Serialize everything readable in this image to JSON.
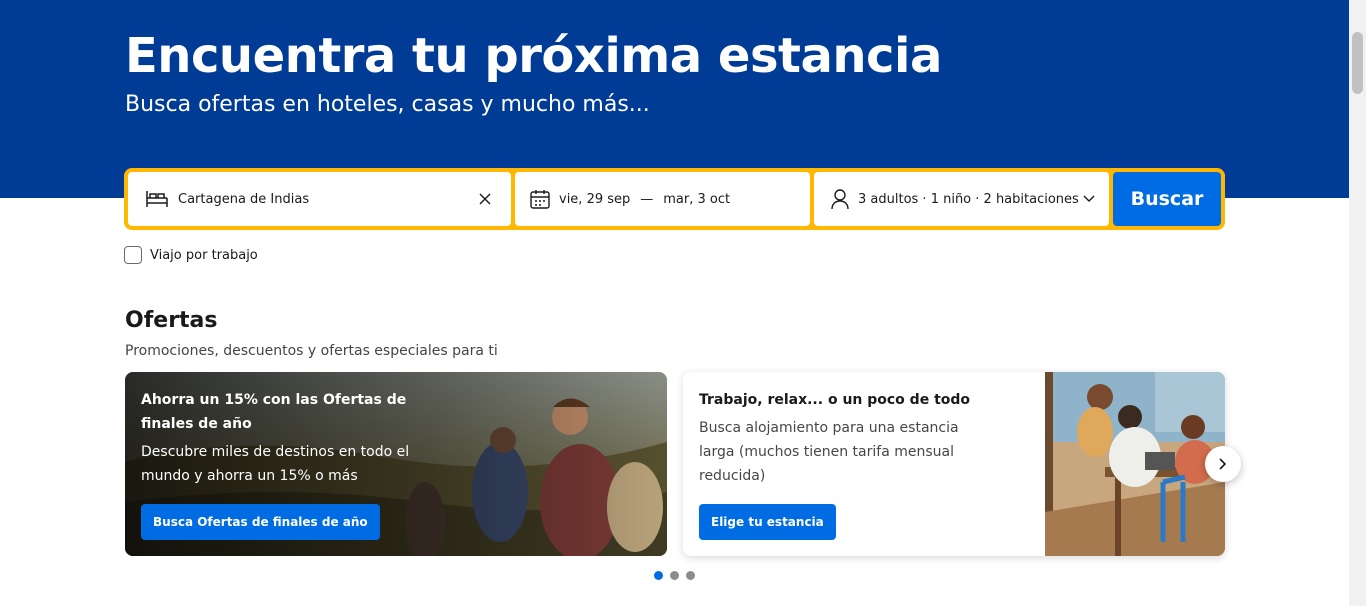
{
  "hero": {
    "title": "Encuentra tu próxima estancia",
    "subtitle": "Busca ofertas en hoteles, casas y mucho más...",
    "background_color": "#003b95"
  },
  "search": {
    "destination_value": "Cartagena de Indias",
    "destination_icon": "bed-icon",
    "clear_icon": "close-icon",
    "checkin": "vie, 29 sep",
    "date_separator": "—",
    "checkout": "mar, 3 oct",
    "calendar_icon": "calendar-icon",
    "occupancy": "3 adultos · 1 niño · 2 habitaciones",
    "occupancy_icon": "person-icon",
    "button_label": "Buscar",
    "border_color": "#ffb700",
    "button_color": "#006ce4"
  },
  "work_trip": {
    "label": "Viajo por trabajo",
    "checked": false
  },
  "offers": {
    "title": "Ofertas",
    "subtitle": "Promociones, descuentos y ofertas especiales para ti",
    "cards": [
      {
        "title": "Ahorra un 15% con las Ofertas de finales de año",
        "description": "Descubre miles de destinos en todo el mundo y ahorra un 15% o más",
        "button_label": "Busca Ofertas de finales de año"
      },
      {
        "title": "Trabajo, relax... o un poco de todo",
        "description": "Busca alojamiento para una estancia larga (muchos tienen tarifa mensual reducida)",
        "button_label": "Elige tu estancia"
      }
    ],
    "carousel_pages": 3,
    "active_page": 1
  }
}
